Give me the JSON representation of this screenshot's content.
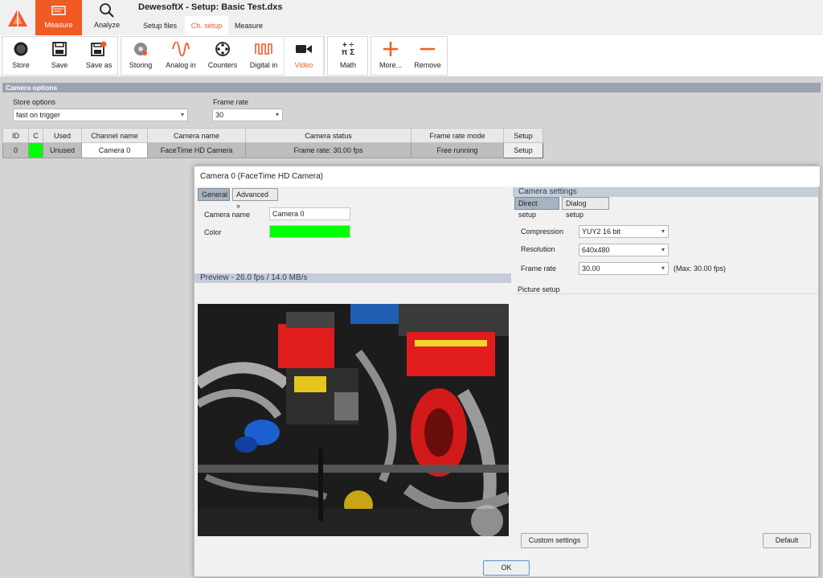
{
  "app": {
    "title": "DewesoftX - Setup: Basic Test.dxs",
    "modes": [
      "Measure",
      "Analyze"
    ],
    "tabs": [
      "Setup files",
      "Ch. setup",
      "Measure"
    ]
  },
  "toolbar": {
    "store": "Store",
    "save": "Save",
    "save_as": "Save as",
    "storing": "Storing",
    "analog_in": "Analog in",
    "counters": "Counters",
    "digital_in": "Digital in",
    "video": "Video",
    "math": "Math",
    "more": "More...",
    "remove": "Remove"
  },
  "camera_options": {
    "header": "Camera options",
    "store_options_label": "Store options",
    "store_options_value": "fast on trigger",
    "frame_rate_label": "Frame rate",
    "frame_rate_value": "30"
  },
  "channel_table": {
    "headers": [
      "ID",
      "C",
      "Used",
      "Channel name",
      "Camera name",
      "Camera status",
      "Frame rate mode",
      "Setup"
    ],
    "row": {
      "id": "0",
      "color": "#00ff00",
      "used": "Unused",
      "channel_name": "Camera 0",
      "camera_name": "FaceTime HD Camera",
      "camera_status": "Frame rate: 30.00 fps",
      "frame_rate_mode": "Free running",
      "setup": "Setup"
    }
  },
  "dialog": {
    "title": "Camera 0 (FaceTime HD Camera)",
    "tab_general": "General",
    "tab_advanced": "Advanced »",
    "camera_name_label": "Camera name",
    "camera_name_value": "Camera 0",
    "color_label": "Color",
    "color_value": "#00ff00",
    "preview_label": "Preview  -  26.0 fps / 14.0 MB/s",
    "camera_settings_label": "Camera settings",
    "tab_direct_setup": "Direct setup",
    "tab_dialog_setup": "Dialog setup",
    "compression_label": "Compression",
    "compression_value": "YUY2 16 bit",
    "resolution_label": "Resolution",
    "resolution_value": "640x480",
    "frame_rate_label": "Frame rate",
    "frame_rate_value": "30.00",
    "max_note": "(Max: 30.00 fps)",
    "picture_setup_label": "Picture setup",
    "custom_settings_button": "Custom settings",
    "default_button": "Default",
    "ok_button": "OK"
  },
  "colors": {
    "accent": "#f15a24",
    "channel_color": "#00ff00"
  }
}
